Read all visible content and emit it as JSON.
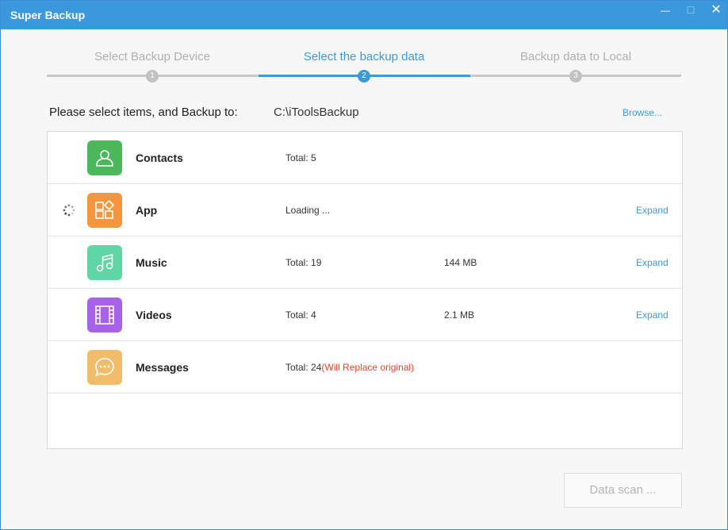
{
  "window": {
    "title": "Super Backup",
    "minimize_glyph": "—",
    "maximize_glyph": "☐",
    "close_glyph": "✕"
  },
  "steps": [
    {
      "label": "Select Backup Device",
      "number": "1",
      "active": false
    },
    {
      "label": "Select the backup data",
      "number": "2",
      "active": true
    },
    {
      "label": "Backup data to Local",
      "number": "3",
      "active": false
    }
  ],
  "destination": {
    "label": "Please select items, and Backup to:",
    "path": "C:\\iToolsBackup",
    "browse_label": "Browse..."
  },
  "items": [
    {
      "name": "Contacts",
      "total": "Total: 5",
      "warning": "",
      "size": "",
      "expand": "",
      "icon": "contact-icon",
      "color": "#4cb85a",
      "loading": false
    },
    {
      "name": "App",
      "total": "Loading ...",
      "warning": "",
      "size": "",
      "expand": "Expand",
      "icon": "apps-icon",
      "color": "#f5963e",
      "loading": true
    },
    {
      "name": "Music",
      "total": "Total: 19",
      "warning": "",
      "size": "144 MB",
      "expand": "Expand",
      "icon": "music-note-icon",
      "color": "#5fd6a3",
      "loading": false
    },
    {
      "name": "Videos",
      "total": "Total: 4",
      "warning": "",
      "size": "2.1 MB",
      "expand": "Expand",
      "icon": "film-icon",
      "color": "#a862e8",
      "loading": false
    },
    {
      "name": "Messages",
      "total": "Total: 24",
      "warning": "(Will Replace original)",
      "size": "",
      "expand": "",
      "icon": "chat-bubble-icon",
      "color": "#f2bd6a",
      "loading": false
    }
  ],
  "scan_button": {
    "label": "Data scan ..."
  }
}
